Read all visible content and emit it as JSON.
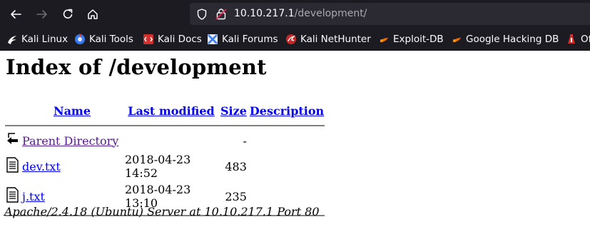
{
  "browser": {
    "url_host": "10.10.217.1",
    "url_path": "/development/",
    "bookmarks": [
      {
        "label": "Kali Linux",
        "icon": "kali-dragon-icon"
      },
      {
        "label": "Kali Tools",
        "icon": "kali-tools-icon"
      },
      {
        "label": "Kali Docs",
        "icon": "kali-docs-icon"
      },
      {
        "label": "Kali Forums",
        "icon": "kali-forums-icon"
      },
      {
        "label": "Kali NetHunter",
        "icon": "kali-nethunter-icon"
      },
      {
        "label": "Exploit-DB",
        "icon": "exploit-db-icon"
      },
      {
        "label": "Google Hacking DB",
        "icon": "ghdb-icon"
      },
      {
        "label": "Of",
        "icon": "offsec-icon"
      }
    ]
  },
  "page": {
    "title": "Index of /development",
    "columns": {
      "name": "Name",
      "last_modified": "Last modified",
      "size": "Size",
      "description": "Description"
    },
    "rows": [
      {
        "name": "Parent Directory",
        "modified": "",
        "size": "-",
        "description": "",
        "icon": "back-folder-icon"
      },
      {
        "name": "dev.txt",
        "modified": "2018-04-23 14:52",
        "size": "483",
        "description": "",
        "icon": "text-file-icon"
      },
      {
        "name": "j.txt",
        "modified": "2018-04-23 13:10",
        "size": "235",
        "description": "",
        "icon": "text-file-icon"
      }
    ],
    "address": "Apache/2.4.18 (Ubuntu) Server at 10.10.217.1 Port 80"
  },
  "colors": {
    "chrome_bg": "#1c1b22",
    "urlbar_bg": "#2b2a33",
    "link": "#0000ee",
    "visited_link": "#551a8b"
  }
}
